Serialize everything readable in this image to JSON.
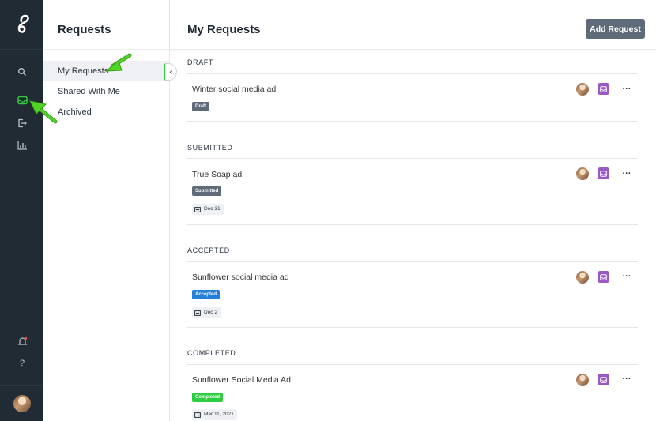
{
  "sidebar": {
    "title": "Requests",
    "items": [
      {
        "label": "My Requests"
      },
      {
        "label": "Shared With Me"
      },
      {
        "label": "Archived"
      }
    ]
  },
  "header": {
    "title": "My Requests",
    "add_button": "Add Request"
  },
  "sections": [
    {
      "heading": "DRAFT",
      "items": [
        {
          "title": "Winter social media ad",
          "status": "Draft",
          "date": ""
        }
      ]
    },
    {
      "heading": "SUBMITTED",
      "items": [
        {
          "title": "True Soap ad",
          "status": "Submitted",
          "date": "Dec 31"
        }
      ]
    },
    {
      "heading": "ACCEPTED",
      "items": [
        {
          "title": "Sunflower social media ad",
          "status": "Accepted",
          "date": "Dec 2"
        }
      ]
    },
    {
      "heading": "COMPLETED",
      "items": [
        {
          "title": "Sunflower Social Media Ad",
          "status": "Completed",
          "date": "Mar 11, 2021"
        }
      ]
    }
  ],
  "colors": {
    "rail_bg": "#212b34",
    "accent_green": "#2ecc40",
    "draft": "#5f6b78",
    "submitted": "#5f6b78",
    "accepted": "#2680d9",
    "completed": "#2ecc40",
    "purple": "#9b59c6"
  },
  "more_glyph": "···"
}
